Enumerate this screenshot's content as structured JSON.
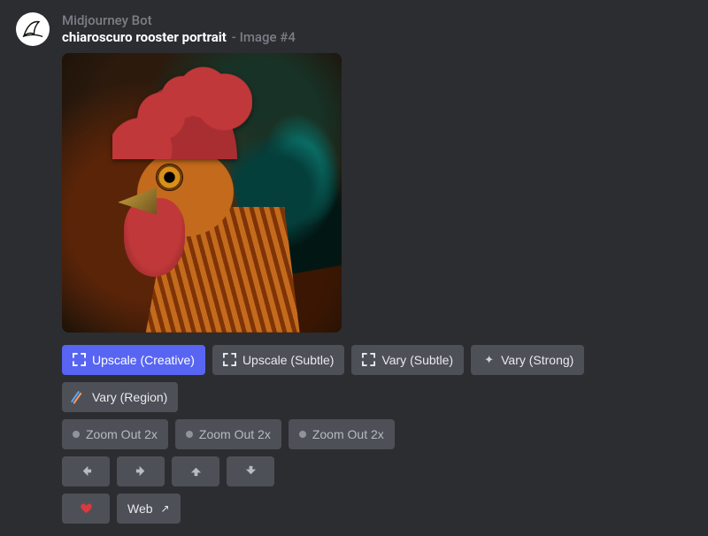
{
  "bot_name": "Midjourney Bot",
  "prompt_title": "chiaroscuro rooster portrait",
  "image_tag": "- Image #4",
  "buttons": {
    "row1": {
      "upscale_creative": "Upscale (Creative)",
      "upscale_subtle": "Upscale (Subtle)",
      "vary_subtle": "Vary (Subtle)",
      "vary_strong": "Vary (Strong)",
      "vary_region": "Vary (Region)"
    },
    "row2": {
      "zoom_a": "Zoom Out 2x",
      "zoom_b": "Zoom Out 2x",
      "zoom_c": "Zoom Out 2x"
    },
    "row4": {
      "web": "Web"
    }
  },
  "icons": {
    "expand": "expand-icon",
    "sparkle": "sparkle-icon",
    "pen": "pen-icon",
    "dot": "dim-dot",
    "arrow_left": "arrow-left-icon",
    "arrow_right": "arrow-right-icon",
    "arrow_up": "arrow-up-icon",
    "arrow_down": "arrow-down-icon",
    "heart": "heart-icon",
    "external": "↗"
  }
}
